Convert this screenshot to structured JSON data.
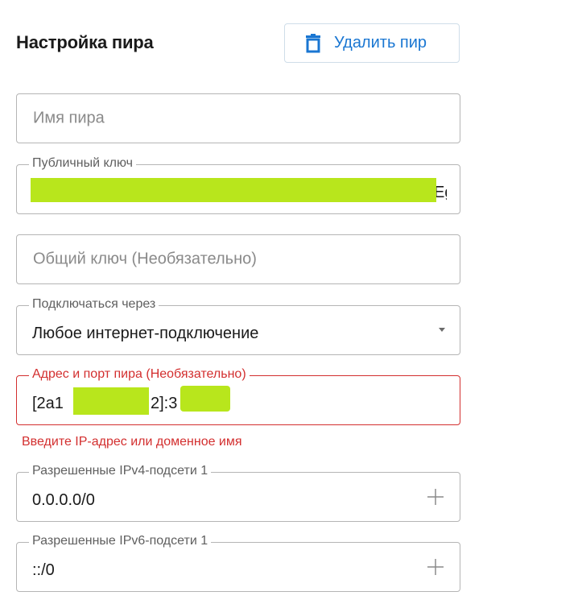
{
  "header": {
    "title": "Настройка пира",
    "delete_label": "Удалить пир"
  },
  "fields": {
    "peer_name": {
      "placeholder": "Имя пира"
    },
    "public_key": {
      "label": "Публичный ключ",
      "value_tail": "Eg"
    },
    "preshared_key": {
      "placeholder": "Общий ключ (Необязательно)"
    },
    "connect_via": {
      "label": "Подключаться через",
      "value": "Любое интернет-подключение"
    },
    "endpoint": {
      "label": "Адрес и порт пира (Необязательно)",
      "value_start": "[2a1",
      "value_mid": "2]:3",
      "error": "Введите IP-адрес или доменное имя"
    },
    "ipv4": {
      "label": "Разрешенные IPv4-подсети 1",
      "value": "0.0.0.0/0"
    },
    "ipv6": {
      "label": "Разрешенные IPv6-подсети 1",
      "value": "::/0"
    }
  },
  "icons": {
    "delete": "trash-icon",
    "dropdown": "chevron-down-icon",
    "add": "plus-icon"
  },
  "colors": {
    "accent": "#1976d2",
    "error": "#d32f2f",
    "redaction": "#b8e61c"
  }
}
